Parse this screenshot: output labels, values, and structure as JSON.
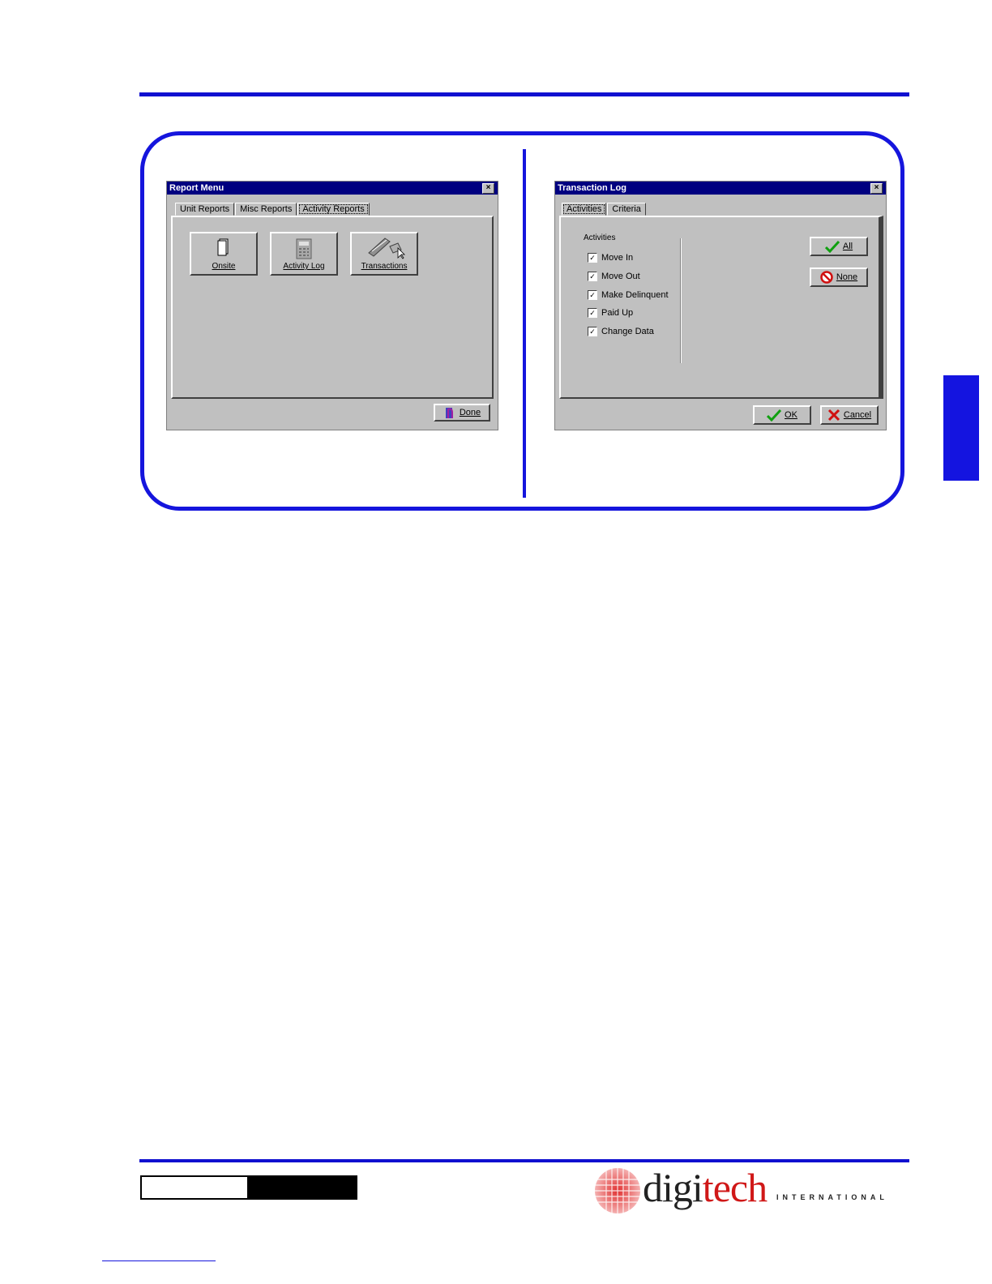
{
  "report_menu": {
    "title": "Report Menu",
    "close_glyph": "×",
    "tabs": [
      "Unit Reports",
      "Misc Reports",
      "Activity Reports"
    ],
    "buttons": [
      {
        "label": "Onsite",
        "icon": "document-icon"
      },
      {
        "label": "Activity Log",
        "icon": "calculator-icon"
      },
      {
        "label": "Transactions",
        "icon": "pen-transactions-icon"
      }
    ],
    "done_label": "Done"
  },
  "transaction_log": {
    "title": "Transaction Log",
    "close_glyph": "×",
    "tabs": [
      "Activities",
      "Criteria"
    ],
    "group_label": "Activities",
    "activities": [
      "Move In",
      "Move Out",
      "Make Delinquent",
      "Paid Up",
      "Change Data"
    ],
    "check_glyph": "✓",
    "all_label": "All",
    "none_label": "None",
    "ok_label": "OK",
    "cancel_label": "Cancel"
  },
  "logo": {
    "brand_dark": "digi",
    "brand_red": "tech",
    "tagline": "INTERNATIONAL"
  },
  "colors": {
    "accent": "#1515dd",
    "brand_red": "#d01818"
  }
}
